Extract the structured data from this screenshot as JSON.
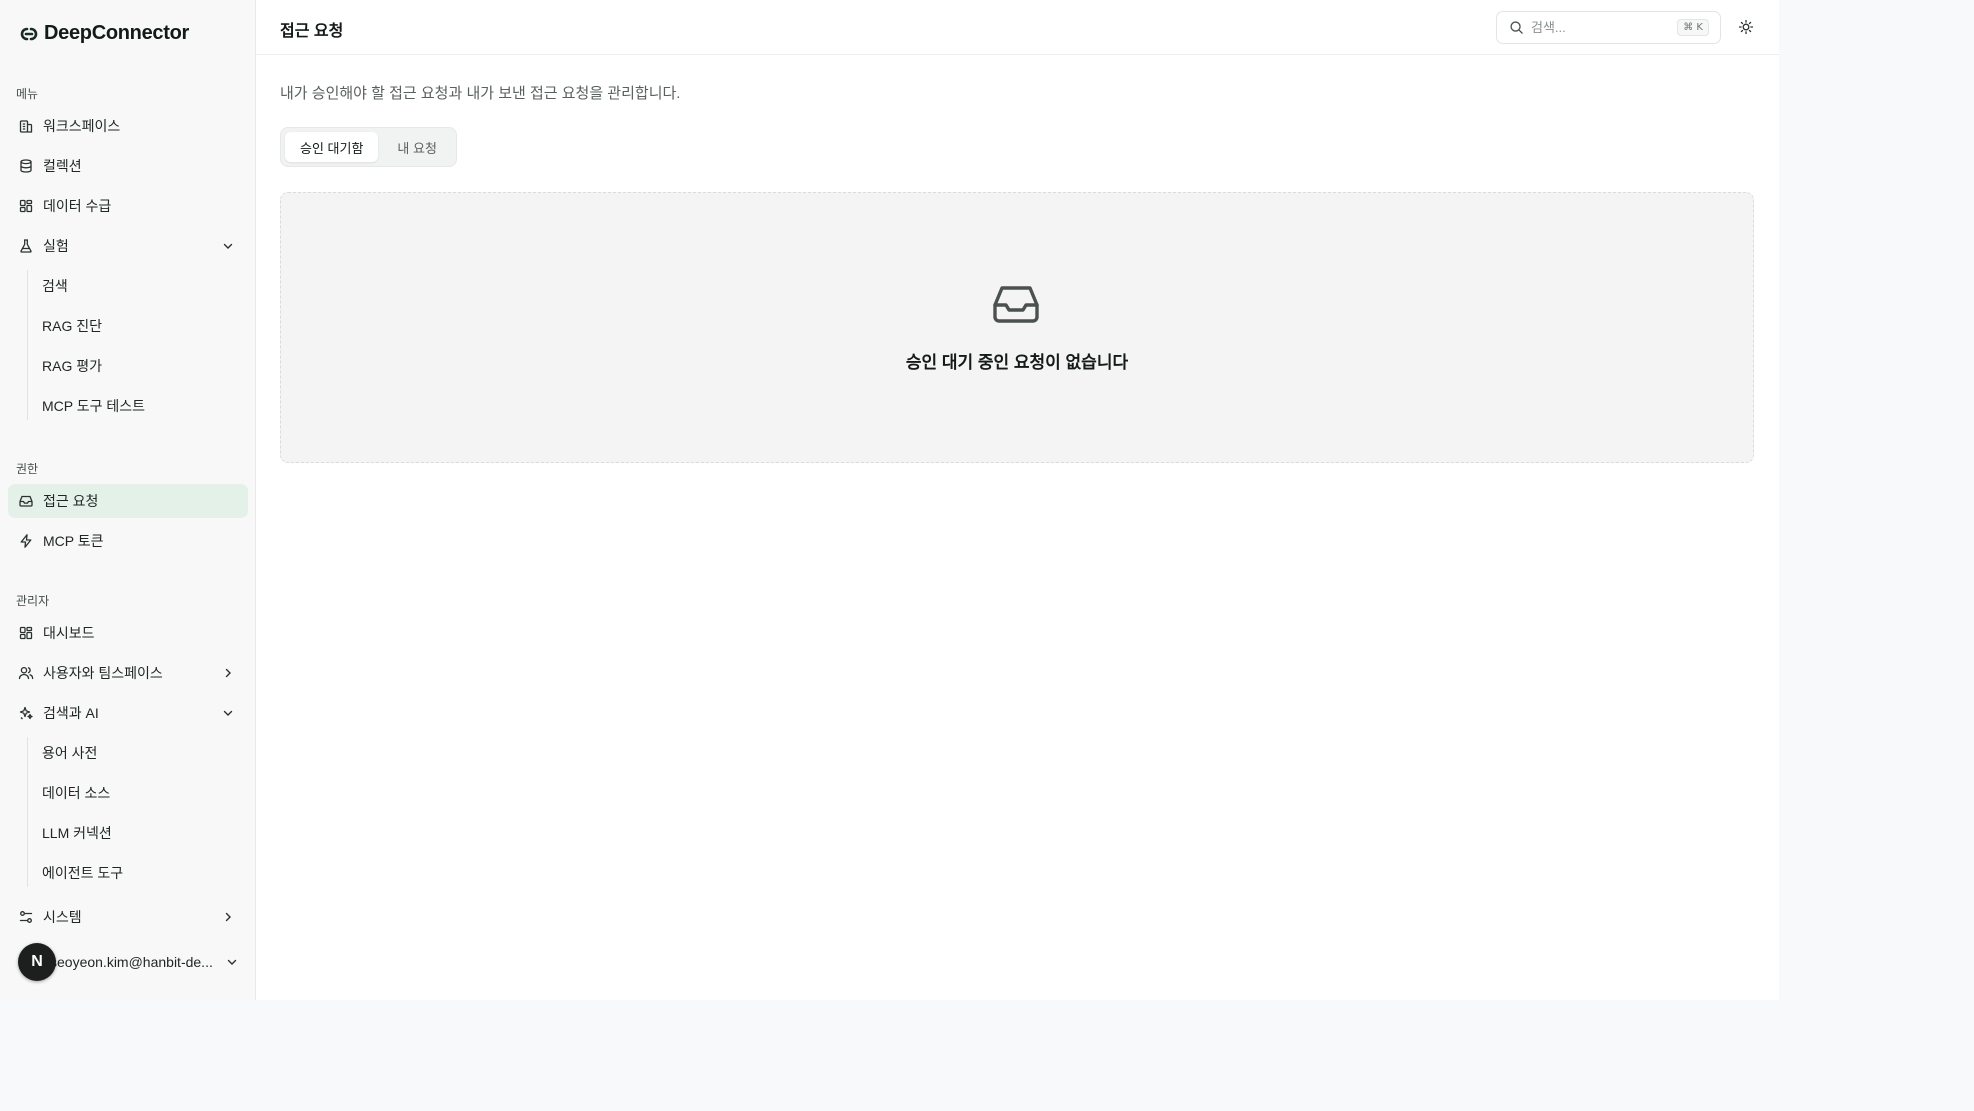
{
  "app": {
    "name": "DeepConnector"
  },
  "sidebar": {
    "menu_label": "메뉴",
    "menu_items": [
      {
        "label": "워크스페이스",
        "icon": "building-icon"
      },
      {
        "label": "컬렉션",
        "icon": "database-icon"
      },
      {
        "label": "데이터 수급",
        "icon": "grid-icon"
      },
      {
        "label": "실험",
        "icon": "flask-icon",
        "expanded": true
      }
    ],
    "experiment_sub": [
      "검색",
      "RAG 진단",
      "RAG 평가",
      "MCP 도구 테스트"
    ],
    "permission_label": "권한",
    "permission_items": [
      {
        "label": "접근 요청",
        "icon": "inbox-icon",
        "active": true
      },
      {
        "label": "MCP 토큰",
        "icon": "zap-icon"
      }
    ],
    "admin_label": "관리자",
    "admin_items": [
      {
        "label": "대시보드",
        "icon": "grid-icon"
      },
      {
        "label": "사용자와 팀스페이스",
        "icon": "users-icon",
        "expanded": false
      },
      {
        "label": "검색과 AI",
        "icon": "sparkles-icon",
        "expanded": true
      }
    ],
    "search_ai_sub": [
      "용어 사전",
      "데이터 소스",
      "LLM 커넥션",
      "에이전트 도구"
    ],
    "system_item": {
      "label": "시스템",
      "icon": "settings-sliders-icon",
      "expanded": false
    },
    "user": {
      "avatar_letter": "N",
      "email": "seoyeon.kim@hanbit-de..."
    }
  },
  "header": {
    "title": "접근 요청",
    "search_placeholder": "검색...",
    "search_shortcut": "⌘ K"
  },
  "main": {
    "subtitle": "내가 승인해야 할 접근 요청과 내가 보낸 접근 요청을 관리합니다.",
    "tabs": [
      {
        "label": "승인 대기함",
        "active": true
      },
      {
        "label": "내 요청",
        "active": false
      }
    ],
    "empty_state": {
      "icon": "inbox-icon",
      "message": "승인 대기 중인 요청이 없습니다"
    }
  },
  "colors": {
    "active_nav_bg": "#e4f1e8",
    "sidebar_bg": "#f7f8f7",
    "empty_card_bg": "#f4f4f4"
  }
}
